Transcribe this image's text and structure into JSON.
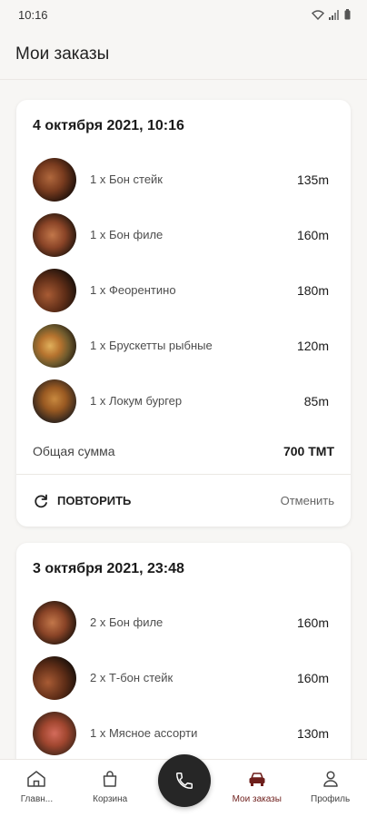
{
  "status_bar": {
    "time": "10:16"
  },
  "header": {
    "title": "Мои заказы"
  },
  "orders": [
    {
      "date": "4 октября 2021, 10:16",
      "items": [
        {
          "name": "1 x Бон стейк",
          "price": "135m"
        },
        {
          "name": "1 x Бон филе",
          "price": "160m"
        },
        {
          "name": "1 x Феорентино",
          "price": "180m"
        },
        {
          "name": "1 x Брускетты рыбные",
          "price": "120m"
        },
        {
          "name": "1 x Локум бургер",
          "price": "85m"
        }
      ],
      "total_label": "Общая сумма",
      "total_value": "700 ТМТ",
      "repeat_label": "ПОВТОРИТЬ",
      "cancel_label": "Отменить"
    },
    {
      "date": "3 октября 2021, 23:48",
      "items": [
        {
          "name": "2 x Бон филе",
          "price": "160m"
        },
        {
          "name": "2 x Т-бон стейк",
          "price": "160m"
        },
        {
          "name": "1 x Мясное ассорти",
          "price": "130m"
        }
      ]
    }
  ],
  "nav": {
    "home": "Главн...",
    "cart": "Корзина",
    "orders": "Мои заказы",
    "profile": "Профиль"
  },
  "colors": {
    "accent": "#6e1f1c",
    "fab": "#262626",
    "background": "#f7f6f4"
  },
  "icons": [
    "wifi-icon",
    "signal-icon",
    "battery-icon",
    "repeat-icon",
    "home-icon",
    "cart-icon",
    "phone-icon",
    "car-icon",
    "profile-icon"
  ]
}
